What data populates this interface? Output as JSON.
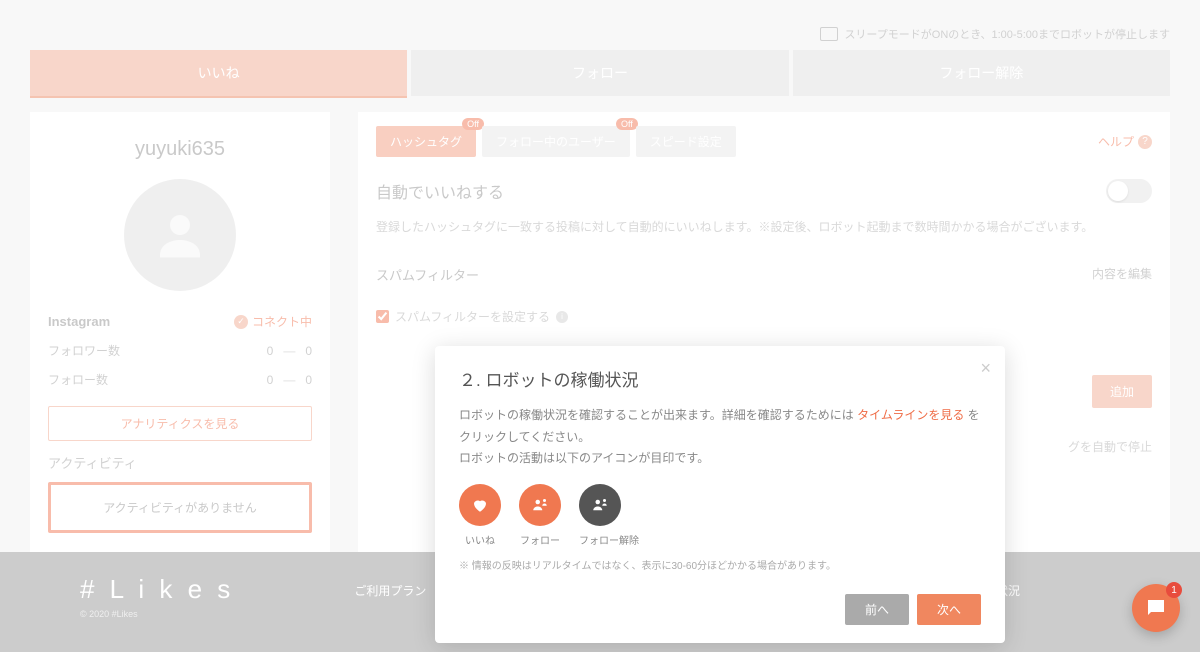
{
  "sleepNote": "スリープモードがONのとき、1:00-5:00までロボットが停止します",
  "tabs": {
    "like": "いいね",
    "follow": "フォロー",
    "unfollow": "フォロー解除"
  },
  "sidebar": {
    "username": "yuyuki635",
    "platform": "Instagram",
    "connectStatus": "コネクト中",
    "follower": {
      "label": "フォロワー数",
      "value": "0",
      "delta": "0"
    },
    "following": {
      "label": "フォロー数",
      "value": "0",
      "delta": "0"
    },
    "analyticsBtn": "アナリティクスを見る",
    "activityLabel": "アクティビティ",
    "noActivity": "アクティビティがありません"
  },
  "subtabs": {
    "hashtag": "ハッシュタグ",
    "followingUser": "フォロー中のユーザー",
    "speed": "スピード設定",
    "offBadge": "Off",
    "help": "ヘルプ"
  },
  "autoLike": {
    "title": "自動でいいねする",
    "desc": "登録したハッシュタグに一致する投稿に対して自動的にいいねします。※設定後、ロボット起動まで数時間かかる場合がございます。"
  },
  "spam": {
    "title": "スパムフィルター",
    "edit": "内容を編集",
    "checkbox": "スパムフィルターを設定する"
  },
  "addBtn": "追加",
  "stopNote": "グを自動で停止",
  "footer": {
    "brand": "# L i k e s",
    "copy": "© 2020 #Likes",
    "plan": "ご利用プラン",
    "status": "稼働状況"
  },
  "popover": {
    "title": "２. ロボットの稼働状況",
    "body1": "ロボットの稼働状況を確認することが出来ます。詳細を確認するためには",
    "link": "タイムラインを見る",
    "body2": "をクリックしてください。",
    "body3": "ロボットの活動は以下のアイコンが目印です。",
    "icons": {
      "like": "いいね",
      "follow": "フォロー",
      "unfollow": "フォロー解除"
    },
    "note": "※ 情報の反映はリアルタイムではなく、表示に30-60分ほどかかる場合があります。",
    "prev": "前へ",
    "next": "次へ"
  },
  "chatBadge": "1"
}
